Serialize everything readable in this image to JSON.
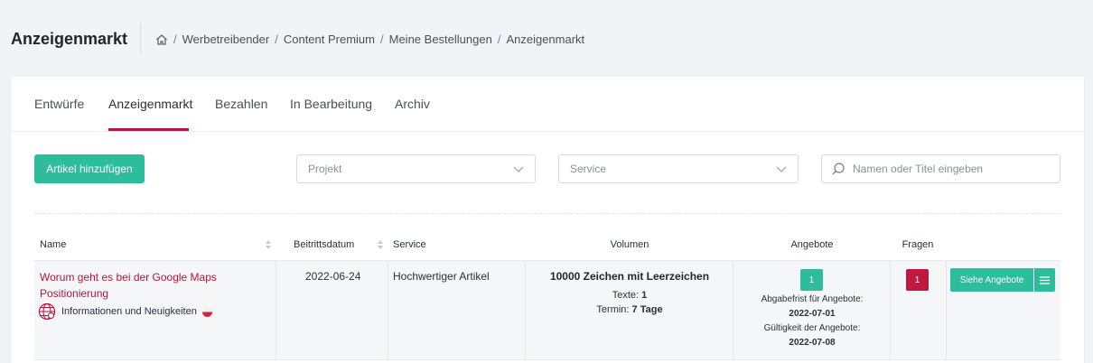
{
  "header": {
    "title": "Anzeigenmarkt",
    "breadcrumb": [
      "Werbetreibender",
      "Content Premium",
      "Meine Bestellungen",
      "Anzeigenmarkt"
    ],
    "separator": "/"
  },
  "tabs": [
    {
      "label": "Entwürfe",
      "active": false
    },
    {
      "label": "Anzeigenmarkt",
      "active": true
    },
    {
      "label": "Bezahlen",
      "active": false
    },
    {
      "label": "In Bearbeitung",
      "active": false
    },
    {
      "label": "Archiv",
      "active": false
    }
  ],
  "toolbar": {
    "add_button": "Artikel hinzufügen",
    "project_placeholder": "Projekt",
    "service_placeholder": "Service",
    "search_placeholder": "Namen oder Titel eingeben"
  },
  "table": {
    "columns": [
      "Name",
      "Beitrittsdatum",
      "Service",
      "Volumen",
      "Angebote",
      "Fragen"
    ],
    "rows": [
      {
        "name": "Worum geht es bei der Google Maps Positionierung",
        "category": "Informationen und Neuigkeiten",
        "date": "2022-06-24",
        "service": "Hochwertiger Artikel",
        "volume_main": "10000 Zeichen mit Leerzeichen",
        "texts_label": "Texte:",
        "texts_value": "1",
        "term_label": "Termin:",
        "term_value": "7 Tage",
        "offers_count": "1",
        "offer_deadline_label": "Abgabefrist für Angebote:",
        "offer_deadline": "2022-07-01",
        "offer_validity_label": "Gültigkeit der Angebote:",
        "offer_validity": "2022-07-08",
        "questions_count": "1",
        "view_offers_button": "Siehe Angebote"
      }
    ]
  },
  "colors": {
    "accent": "#b5163f",
    "green": "#2ebd9c",
    "red_badge": "#c0183f"
  }
}
